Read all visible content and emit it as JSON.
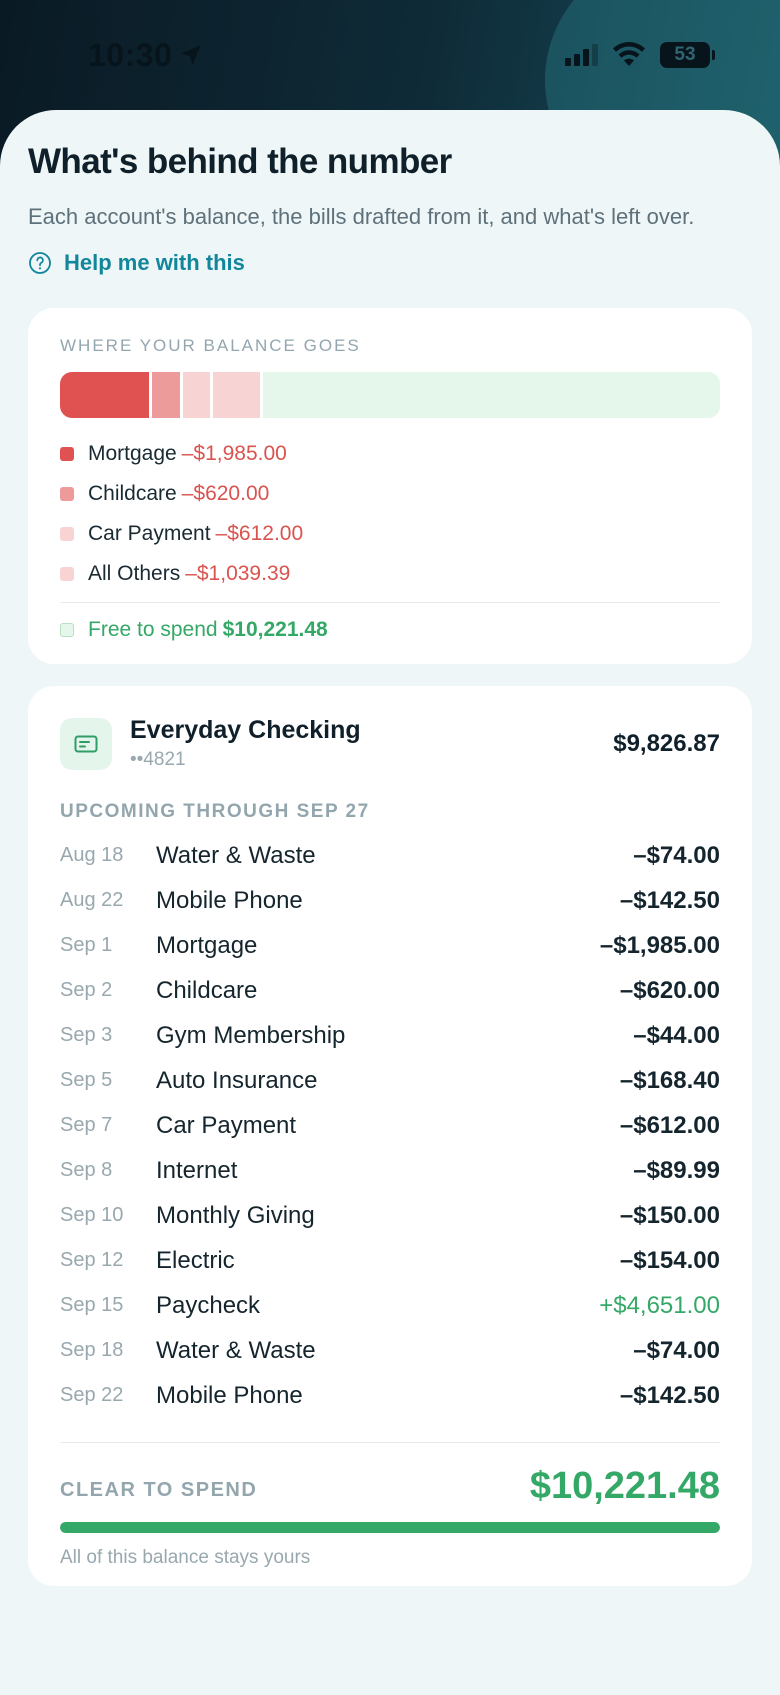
{
  "status_bar": {
    "time": "10:30",
    "battery": "53"
  },
  "header": {
    "title": "What's behind the number",
    "subtitle": "Each account's balance, the bills drafted from it, and what's left over.",
    "help_label": "Help me with this"
  },
  "balance_breakdown": {
    "label": "WHERE YOUR BALANCE GOES",
    "segments": [
      {
        "name": "Mortgage",
        "amount": "–$1,985.00",
        "value": 1985.0,
        "color": "#e05252"
      },
      {
        "name": "Childcare",
        "amount": "–$620.00",
        "value": 620.0,
        "color": "#ec9a9a"
      },
      {
        "name": "Car Payment",
        "amount": "–$612.00",
        "value": 612.0,
        "color": "#f7d3d3"
      },
      {
        "name": "All Others",
        "amount": "–$1,039.39",
        "value": 1039.39,
        "color": "#f7d3d3"
      }
    ],
    "free": {
      "label": "Free to spend",
      "amount": "$10,221.48",
      "value": 10221.48,
      "color": "#e5f6ea"
    }
  },
  "account": {
    "name": "Everyday Checking",
    "mask": "••4821",
    "balance": "$9,826.87",
    "upcoming_label": "UPCOMING THROUGH SEP 27",
    "bills": [
      {
        "date": "Aug 18",
        "name": "Water & Waste",
        "amount": "–$74.00",
        "positive": false
      },
      {
        "date": "Aug 22",
        "name": "Mobile Phone",
        "amount": "–$142.50",
        "positive": false
      },
      {
        "date": "Sep 1",
        "name": "Mortgage",
        "amount": "–$1,985.00",
        "positive": false
      },
      {
        "date": "Sep 2",
        "name": "Childcare",
        "amount": "–$620.00",
        "positive": false
      },
      {
        "date": "Sep 3",
        "name": "Gym Membership",
        "amount": "–$44.00",
        "positive": false
      },
      {
        "date": "Sep 5",
        "name": "Auto Insurance",
        "amount": "–$168.40",
        "positive": false
      },
      {
        "date": "Sep 7",
        "name": "Car Payment",
        "amount": "–$612.00",
        "positive": false
      },
      {
        "date": "Sep 8",
        "name": "Internet",
        "amount": "–$89.99",
        "positive": false
      },
      {
        "date": "Sep 10",
        "name": "Monthly Giving",
        "amount": "–$150.00",
        "positive": false
      },
      {
        "date": "Sep 12",
        "name": "Electric",
        "amount": "–$154.00",
        "positive": false
      },
      {
        "date": "Sep 15",
        "name": "Paycheck",
        "amount": "+$4,651.00",
        "positive": true
      },
      {
        "date": "Sep 18",
        "name": "Water & Waste",
        "amount": "–$74.00",
        "positive": false
      },
      {
        "date": "Sep 22",
        "name": "Mobile Phone",
        "amount": "–$142.50",
        "positive": false
      }
    ],
    "clear_label": "CLEAR TO SPEND",
    "clear_amount": "$10,221.48",
    "clear_fraction": 1.0,
    "clear_caption": "All of this balance stays yours"
  },
  "colors": {
    "accent": "#12869a",
    "positive": "#34a866",
    "negative": "#d9534f"
  }
}
